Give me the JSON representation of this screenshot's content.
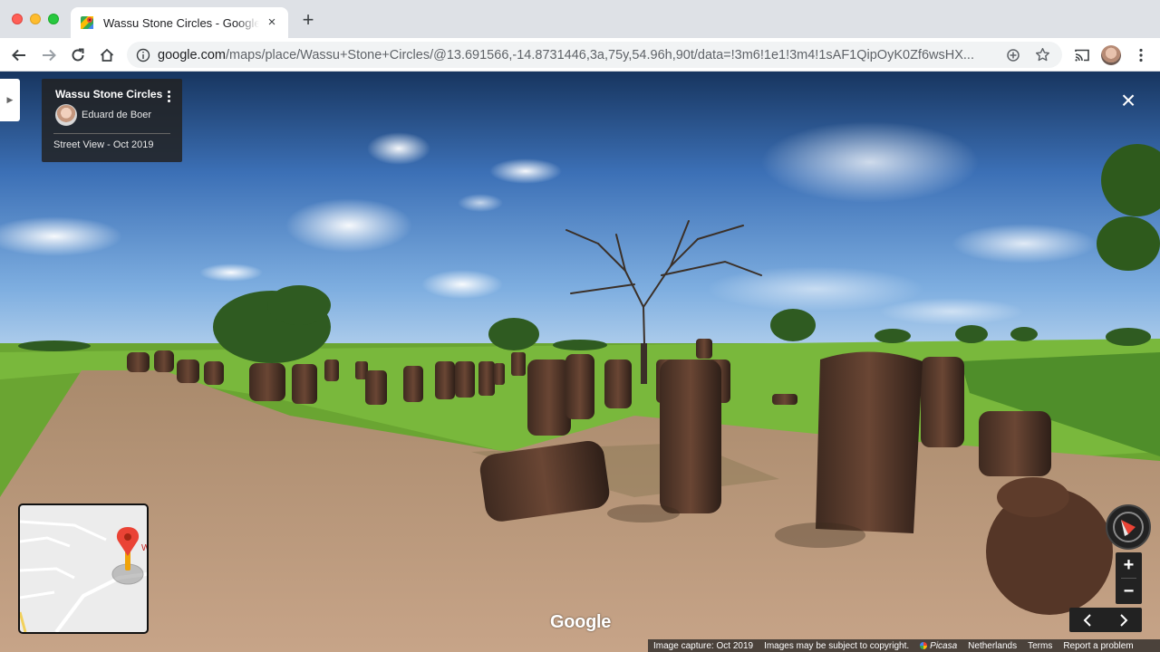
{
  "browser": {
    "tab": {
      "title": "Wassu Stone Circles - Google Maps",
      "close": "×"
    },
    "new_tab": "+",
    "url": {
      "host": "google.com",
      "path": "/maps/place/Wassu+Stone+Circles/@13.691566,-14.8731446,3a,75y,54.96h,90t/data=!3m6!1e1!3m4!1sAF1QipOyK0Zf6wsHX..."
    }
  },
  "street_view": {
    "place_title": "Wassu Stone Circles",
    "author": "Eduard de Boer",
    "capture_label": "Street View - Oct 2019",
    "close": "×",
    "google_logo": "Google",
    "zoom_in": "+",
    "zoom_out": "−",
    "minimap_label": "W",
    "side_toggle": "▶"
  },
  "footer": {
    "capture": "Image capture: Oct 2019",
    "copyright": "Images may be subject to copyright.",
    "provider": "Picasa",
    "region": "Netherlands",
    "terms": "Terms",
    "report": "Report a problem"
  },
  "colors": {
    "accent_red": "#ea4335",
    "panel_dark": "#222222"
  }
}
